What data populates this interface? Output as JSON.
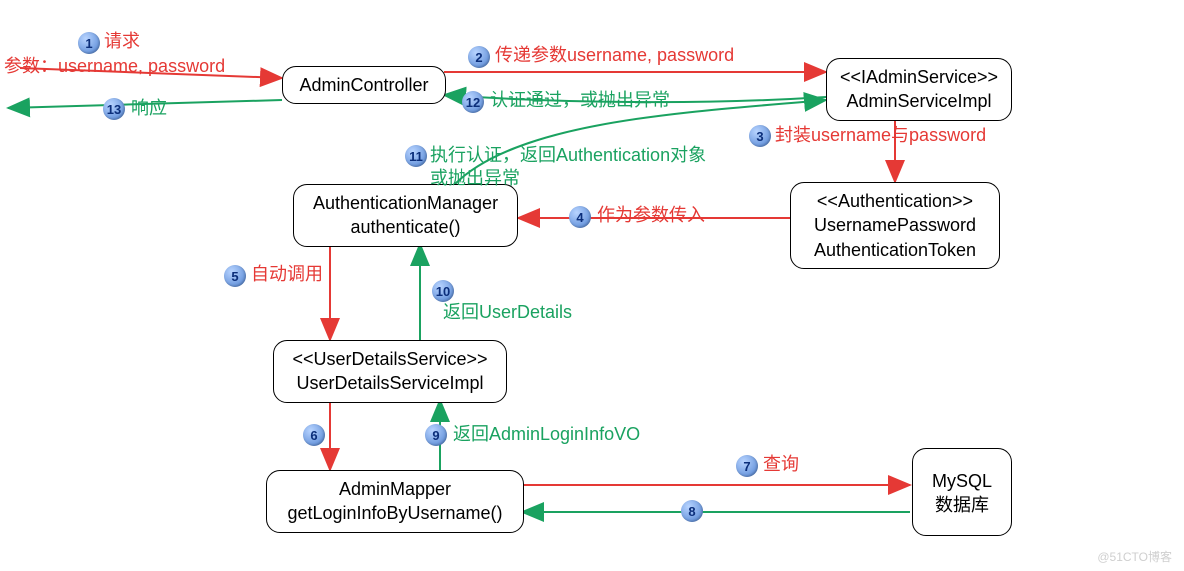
{
  "nodes": {
    "adminController": "AdminController",
    "adminService1": "<<IAdminService>>",
    "adminService2": "AdminServiceImpl",
    "authToken1": "<<Authentication>>",
    "authToken2": "UsernamePassword",
    "authToken3": "AuthenticationToken",
    "authManager1": "AuthenticationManager",
    "authManager2": "authenticate()",
    "userDetails1": "<<UserDetailsService>>",
    "userDetails2": "UserDetailsServiceImpl",
    "adminMapper1": "AdminMapper",
    "adminMapper2": "getLoginInfoByUsername()",
    "mysql1": "MySQL",
    "mysql2": "数据库"
  },
  "labels": {
    "l1": "请求",
    "l1a": "参数：username, password",
    "l2": "传递参数username, password",
    "l3": "封装username与password",
    "l4": "作为参数传入",
    "l5": "自动调用",
    "l7": "查询",
    "l9": "返回AdminLoginInfoVO",
    "l10": "返回UserDetails",
    "l11": "执行认证，返回Authentication对象\n或抛出异常",
    "l12": "认证通过，或抛出异常",
    "l13": "响应"
  },
  "steps": {
    "s1": "1",
    "s2": "2",
    "s3": "3",
    "s4": "4",
    "s5": "5",
    "s6": "6",
    "s7": "7",
    "s8": "8",
    "s9": "9",
    "s10": "10",
    "s11": "11",
    "s12": "12",
    "s13": "13"
  },
  "watermark": "@51CTO博客"
}
